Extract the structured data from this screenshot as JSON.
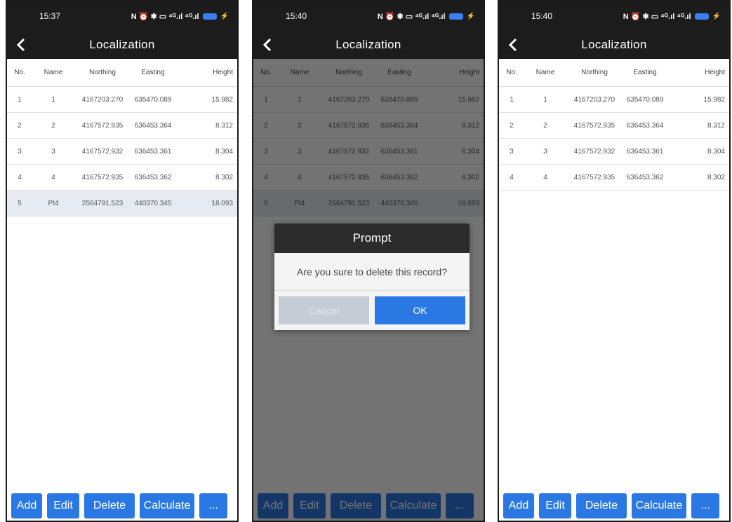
{
  "title": "Localization",
  "accent_color": "#2a78e4",
  "columns": [
    "No.",
    "Name",
    "Northing",
    "Easting",
    "Height"
  ],
  "buttons": {
    "add": "Add",
    "edit": "Edit",
    "delete": "Delete",
    "calculate": "Calculate",
    "more": "..."
  },
  "dialog": {
    "title": "Prompt",
    "message": "Are you sure to delete this record?",
    "cancel": "Cancel",
    "ok": "OK"
  },
  "status_icons": "N ⏰ ✱ ▭ ⁴ᴳ.ıl ⁴ᴳ.ıl",
  "screens": [
    {
      "time": "15:37",
      "rows": [
        {
          "no": "1",
          "name": "1",
          "northing": "4167203.270",
          "easting": "635470.089",
          "height": "15.982"
        },
        {
          "no": "2",
          "name": "2",
          "northing": "4167572.935",
          "easting": "636453.364",
          "height": "8.312"
        },
        {
          "no": "3",
          "name": "3",
          "northing": "4167572.932",
          "easting": "636453.361",
          "height": "8.304"
        },
        {
          "no": "4",
          "name": "4",
          "northing": "4167572.935",
          "easting": "636453.362",
          "height": "8.302"
        },
        {
          "no": "5",
          "name": "Pt4",
          "northing": "2564791.523",
          "easting": "440370.345",
          "height": "18.093",
          "selected": true
        }
      ]
    },
    {
      "time": "15:40",
      "rows": [
        {
          "no": "1",
          "name": "1",
          "northing": "4167203.270",
          "easting": "635470.089",
          "height": "15.982"
        },
        {
          "no": "2",
          "name": "2",
          "northing": "4167572.935",
          "easting": "636453.364",
          "height": "8.312"
        },
        {
          "no": "3",
          "name": "3",
          "northing": "4167572.932",
          "easting": "636453.361",
          "height": "8.304"
        },
        {
          "no": "4",
          "name": "4",
          "northing": "4167572.935",
          "easting": "636453.362",
          "height": "8.302"
        },
        {
          "no": "5",
          "name": "Pt4",
          "northing": "2564791.523",
          "easting": "440370.345",
          "height": "18.093",
          "selected": true
        }
      ]
    },
    {
      "time": "15:40",
      "rows": [
        {
          "no": "1",
          "name": "1",
          "northing": "4167203.270",
          "easting": "635470.089",
          "height": "15.982"
        },
        {
          "no": "2",
          "name": "2",
          "northing": "4167572.935",
          "easting": "636453.364",
          "height": "8.312"
        },
        {
          "no": "3",
          "name": "3",
          "northing": "4167572.932",
          "easting": "636453.361",
          "height": "8.304"
        },
        {
          "no": "4",
          "name": "4",
          "northing": "4167572.935",
          "easting": "636453.362",
          "height": "8.302"
        }
      ]
    }
  ]
}
